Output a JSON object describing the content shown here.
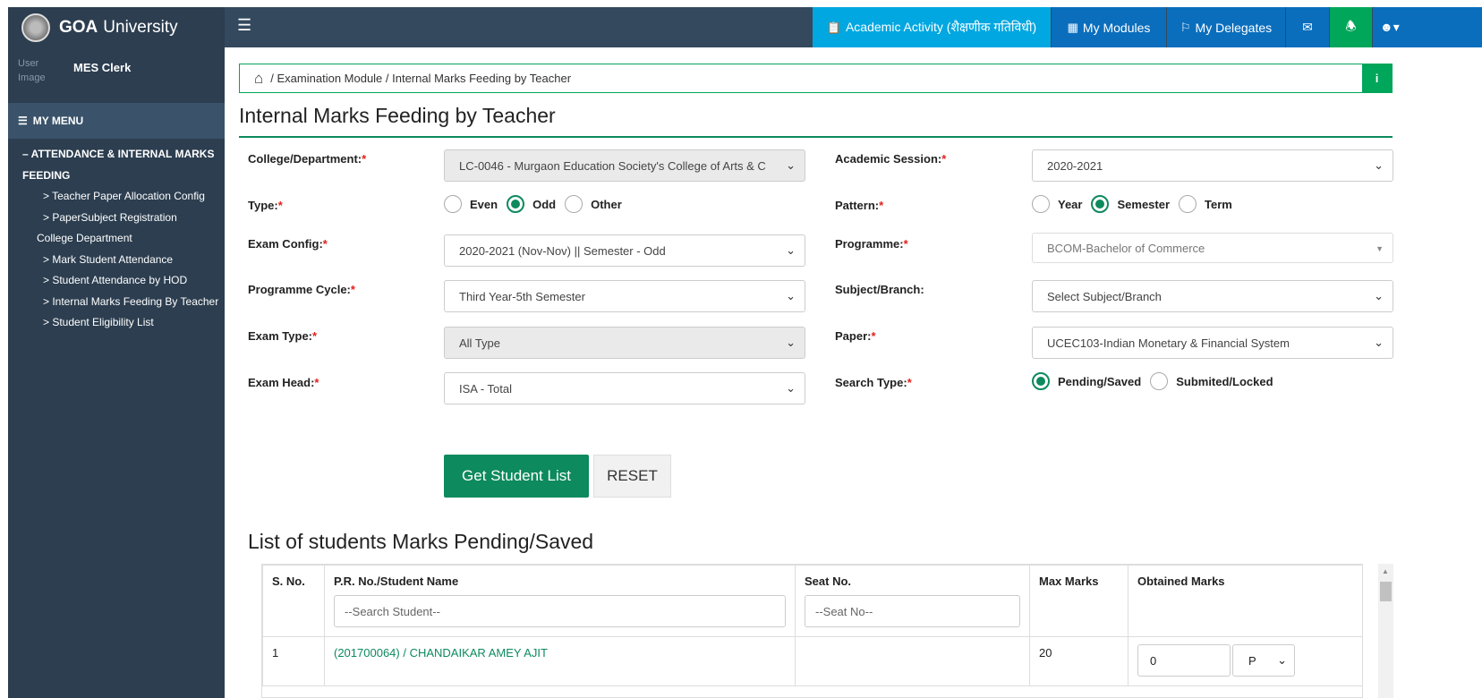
{
  "app": {
    "name_bold": "GOA",
    "name_rest": "University"
  },
  "topnav": {
    "academic": "Academic Activity (शैक्षणीक गतिविधी)",
    "modules": "My Modules",
    "delegates": "My Delegates"
  },
  "user": {
    "image_alt": "User Image",
    "name": "MES Clerk"
  },
  "menu": {
    "header": "MY MENU",
    "group": "– ATTENDANCE & INTERNAL MARKS FEEDING",
    "items": [
      "> Teacher Paper Allocation Config",
      "> PaperSubject Registration",
      "College Department",
      "> Mark Student Attendance",
      "> Student Attendance by HOD",
      "> Internal Marks Feeding By Teacher",
      "> Student Eligibility List"
    ]
  },
  "breadcrumb": "/ Examination Module / Internal Marks Feeding by Teacher",
  "page_title": "Internal Marks Feeding by Teacher",
  "form": {
    "college_label": "College/Department:",
    "college_value": "LC-0046 - Murgaon Education Society's College of Arts & C",
    "session_label": "Academic Session:",
    "session_value": "2020-2021",
    "type_label": "Type:",
    "type_options": [
      "Even",
      "Odd",
      "Other"
    ],
    "type_selected": "Odd",
    "pattern_label": "Pattern:",
    "pattern_options": [
      "Year",
      "Semester",
      "Term"
    ],
    "pattern_selected": "Semester",
    "examconfig_label": "Exam Config:",
    "examconfig_value": "2020-2021 (Nov-Nov) || Semester - Odd",
    "programme_label": "Programme:",
    "programme_value": "BCOM-Bachelor of Commerce",
    "cycle_label": "Programme Cycle:",
    "cycle_value": "Third Year-5th Semester",
    "subject_label": "Subject/Branch:",
    "subject_value": "Select Subject/Branch",
    "examtype_label": "Exam Type:",
    "examtype_value": "All Type",
    "paper_label": "Paper:",
    "paper_value": "UCEC103-Indian Monetary & Financial System",
    "examhead_label": "Exam Head:",
    "examhead_value": "ISA - Total",
    "searchtype_label": "Search Type:",
    "searchtype_options": [
      "Pending/Saved",
      "Submited/Locked"
    ],
    "searchtype_selected": "Pending/Saved",
    "required_mark": "*"
  },
  "buttons": {
    "get": "Get Student List",
    "reset": "RESET"
  },
  "list": {
    "title": "List of students Marks Pending/Saved",
    "columns": [
      "S. No.",
      "P.R. No./Student Name",
      "Seat No.",
      "Max Marks",
      "Obtained Marks"
    ],
    "search_student_placeholder": "--Search Student--",
    "seat_placeholder": "--Seat No--",
    "rows": [
      {
        "sno": "1",
        "student": "(201700064) / CHANDAIKAR AMEY AJIT",
        "seat": "",
        "max": "20",
        "obtained": "0",
        "status": "P"
      }
    ]
  }
}
